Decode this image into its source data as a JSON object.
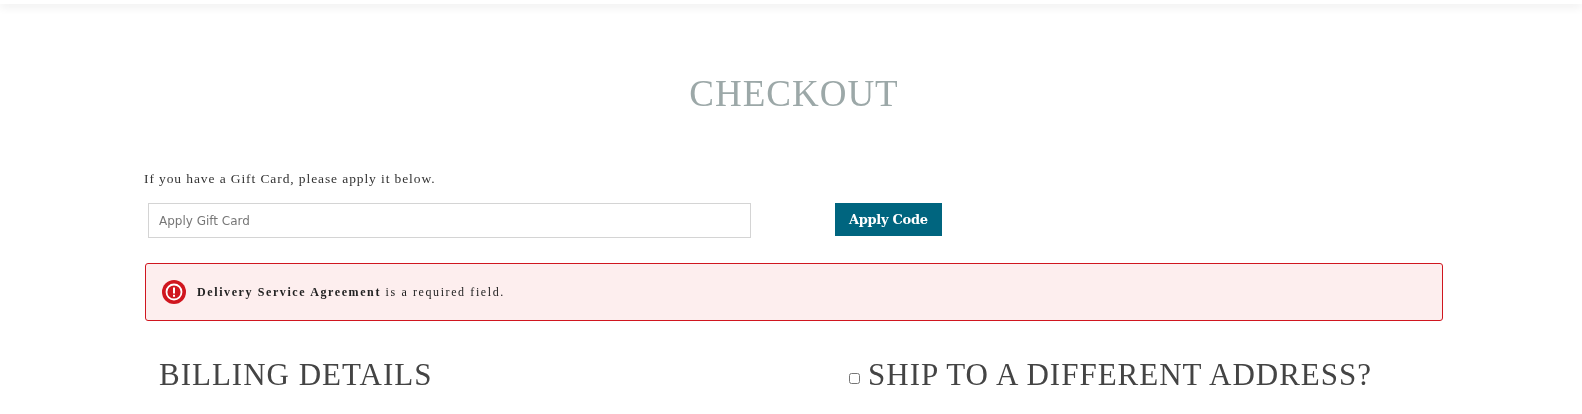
{
  "page": {
    "title": "CHECKOUT"
  },
  "gift_card": {
    "prompt": "If you have a Gift Card, please apply it below.",
    "field": {
      "placeholder": "Apply Gift Card"
    },
    "button": "Apply Code"
  },
  "alert": {
    "message": "**Delivery Service Agreement** is a required field."
  },
  "billing": {
    "heading": "BILLING DETAILS"
  },
  "shipping": {
    "heading": "SHIP TO A DIFFERENT ADDRESS?",
    "checked": false
  }
}
